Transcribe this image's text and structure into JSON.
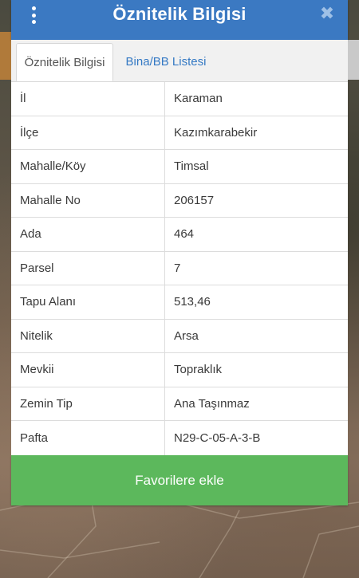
{
  "header": {
    "title": "Öznitelik Bilgisi",
    "close_glyph": "✖"
  },
  "tabs": [
    {
      "label": "Öznitelik Bilgisi",
      "active": true
    },
    {
      "label": "Bina/BB Listesi",
      "active": false
    }
  ],
  "attributes": [
    {
      "key": "İl",
      "value": "Karaman"
    },
    {
      "key": "İlçe",
      "value": "Kazımkarabekir"
    },
    {
      "key": "Mahalle/Köy",
      "value": "Timsal"
    },
    {
      "key": "Mahalle No",
      "value": "206157"
    },
    {
      "key": "Ada",
      "value": "464"
    },
    {
      "key": "Parsel",
      "value": "7"
    },
    {
      "key": "Tapu Alanı",
      "value": "513,46"
    },
    {
      "key": "Nitelik",
      "value": "Arsa"
    },
    {
      "key": "Mevkii",
      "value": "Topraklık"
    },
    {
      "key": "Zemin Tip",
      "value": "Ana Taşınmaz"
    },
    {
      "key": "Pafta",
      "value": "N29-C-05-A-3-B"
    }
  ],
  "footer": {
    "favorite_label": "Favorilere ekle"
  },
  "colors": {
    "header_bg": "#3b79c2",
    "tab_link": "#3479c4",
    "button_bg": "#5cb85c"
  },
  "icons": {
    "menu": "vertical-dots-icon",
    "close": "close-icon"
  }
}
